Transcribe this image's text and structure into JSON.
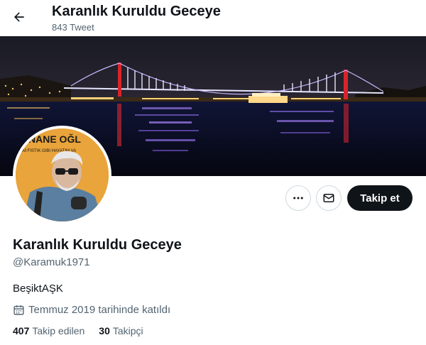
{
  "header": {
    "title": "Karanlık Kuruldu Geceye",
    "tweet_count": "843 Tweet"
  },
  "avatar": {
    "text_top": "NANE OĞL",
    "text_sub": "NIM FISTIK GIBI HAYATIM VA"
  },
  "actions": {
    "follow_label": "Takip et"
  },
  "profile": {
    "display_name": "Karanlık Kuruldu Geceye",
    "handle": "@Karamuk1971",
    "bio": "BeşiktAŞK",
    "joined": "Temmuz 2019 tarihinde katıldı"
  },
  "stats": {
    "following_count": "407",
    "following_label": "Takip edilen",
    "followers_count": "30",
    "followers_label": "Takipçi"
  },
  "colors": {
    "text_primary": "#0f1419",
    "text_secondary": "#536471",
    "border": "#cfd9de",
    "follow_bg": "#0f1419",
    "avatar_bg": "#e9a43b"
  },
  "icons": {
    "back": "arrow-left-icon",
    "more": "more-dots-icon",
    "message": "envelope-icon",
    "calendar": "calendar-icon"
  }
}
